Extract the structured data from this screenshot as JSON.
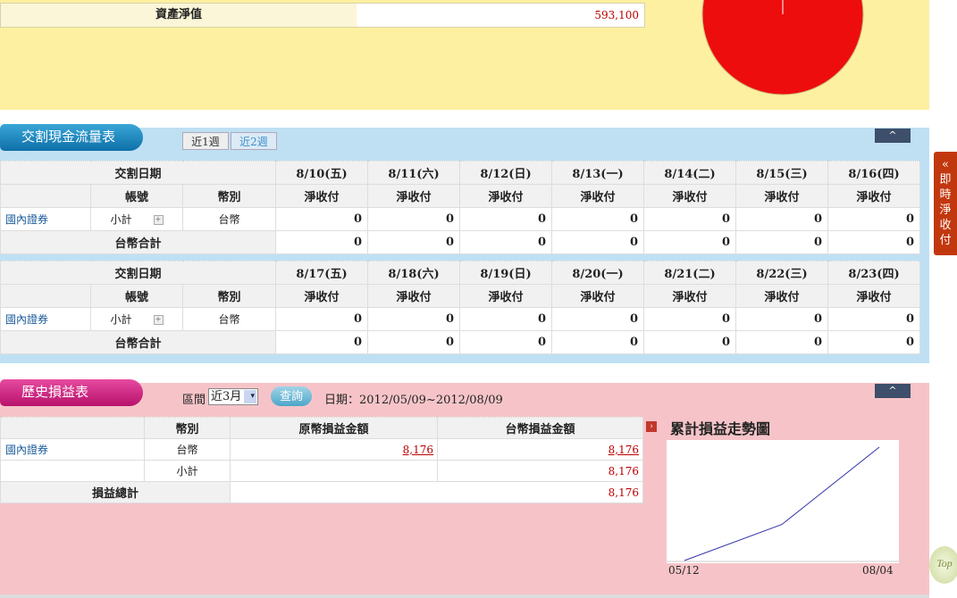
{
  "asset": {
    "label": "資產淨值",
    "value": "593,100"
  },
  "cashflow": {
    "title": "交割現金流量表",
    "toggle": [
      "近1週",
      "近2週"
    ],
    "collapse_icon": "^",
    "headers": {
      "date": "交割日期",
      "account": "帳號",
      "currency": "幣別",
      "col": "淨收付"
    },
    "weeks": [
      {
        "dates": [
          "8/10(五)",
          "8/11(六)",
          "8/12(日)",
          "8/13(一)",
          "8/14(二)",
          "8/15(三)",
          "8/16(四)"
        ],
        "row": {
          "name": "國內證券",
          "sub": "小計",
          "plus": "+",
          "currency": "台幣",
          "values": [
            "0",
            "0",
            "0",
            "0",
            "0",
            "0",
            "0"
          ]
        },
        "total": {
          "label": "台幣合計",
          "values": [
            "0",
            "0",
            "0",
            "0",
            "0",
            "0",
            "0"
          ]
        }
      },
      {
        "dates": [
          "8/17(五)",
          "8/18(六)",
          "8/19(日)",
          "8/20(一)",
          "8/21(二)",
          "8/22(三)",
          "8/23(四)"
        ],
        "row": {
          "name": "國內證券",
          "sub": "小計",
          "plus": "+",
          "currency": "台幣",
          "values": [
            "0",
            "0",
            "0",
            "0",
            "0",
            "0",
            "0"
          ]
        },
        "total": {
          "label": "台幣合計",
          "values": [
            "0",
            "0",
            "0",
            "0",
            "0",
            "0",
            "0"
          ]
        }
      }
    ]
  },
  "history": {
    "title": "歷史損益表",
    "range_label": "區間",
    "range_value": "近3月",
    "range_arrow": "▾",
    "query_label": "查詢",
    "date_range": "日期：2012/05/09~2012/08/09",
    "collapse_icon": "^",
    "headers": {
      "currency": "幣別",
      "orig": "原幣損益金額",
      "twd": "台幣損益金額"
    },
    "rows": [
      {
        "name": "國內證券",
        "currency": "台幣",
        "orig": "8,176",
        "twd": "8,176"
      },
      {
        "name": "",
        "currency": "小計",
        "orig": "",
        "twd": "8,176"
      }
    ],
    "total": {
      "label": "損益總計",
      "twd": "8,176"
    },
    "chart_title": "累計損益走勢圖",
    "chart_icon": "›"
  },
  "chart_data": {
    "type": "line",
    "title": "累計損益走勢圖",
    "x_labels": [
      "05/12",
      "08/04"
    ],
    "series": [
      {
        "values": [
          0,
          2600,
          8176
        ]
      }
    ],
    "line_color": "#3333aa"
  },
  "side_tab": {
    "label": "«即時淨收付"
  },
  "top_button": {
    "label": "Top"
  }
}
